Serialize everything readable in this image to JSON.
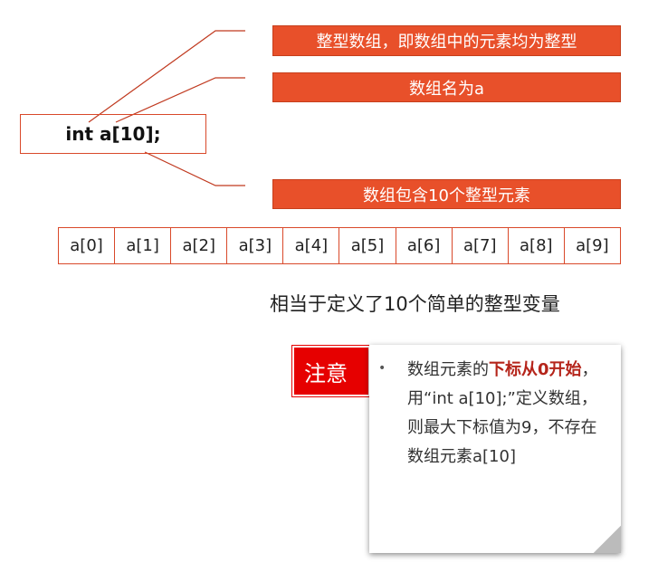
{
  "declaration": "int a[10];",
  "callouts": {
    "type_note": "整型数组，即数组中的元素均为整型",
    "name_note": "数组名为a",
    "size_note": "数组包含10个整型元素"
  },
  "array_cells": [
    "a[0]",
    "a[1]",
    "a[2]",
    "a[3]",
    "a[4]",
    "a[5]",
    "a[6]",
    "a[7]",
    "a[8]",
    "a[9]"
  ],
  "equivalence": "相当于定义了10个简单的整型变量",
  "note": {
    "tag": "注意",
    "bullet": "•",
    "text_part1": "数组元素的",
    "text_highlight": "下标从0开始",
    "text_part2": "，用“int a[10];”定义数组，则最大下标值为9，不存在数组元素a[10]"
  },
  "colors": {
    "callout_bg": "#e8502a",
    "tag_bg": "#e60000",
    "highlight": "#b5251b"
  }
}
